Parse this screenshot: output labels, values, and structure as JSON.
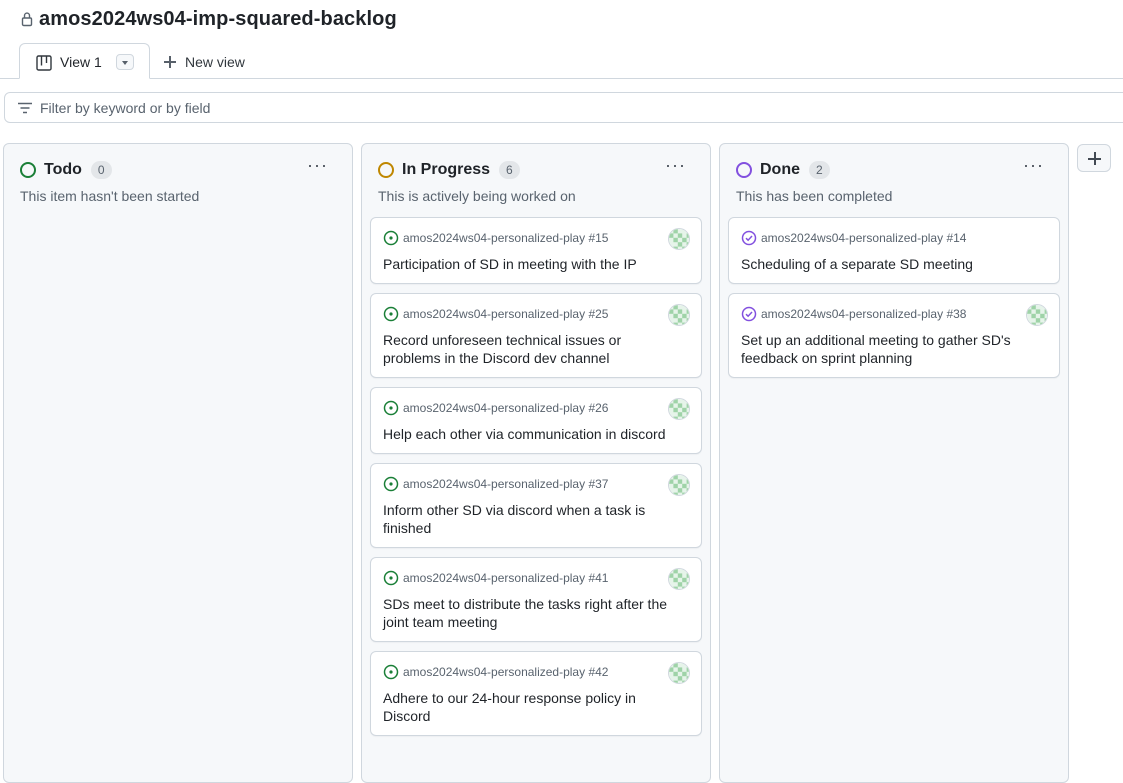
{
  "project": {
    "title": "amos2024ws04-imp-squared-backlog"
  },
  "views": {
    "active_tab": "View 1",
    "new_view_label": "New view"
  },
  "filter": {
    "placeholder": "Filter by keyword or by field"
  },
  "colors": {
    "todo": "#1a7f37",
    "in_progress": "#9a6700",
    "done": "#8250df",
    "open_issue": "#1a7f37",
    "closed_issue": "#8250df"
  },
  "columns": [
    {
      "name": "Todo",
      "count": "0",
      "description": "This item hasn't been started",
      "cards": []
    },
    {
      "name": "In Progress",
      "count": "6",
      "description": "This is actively being worked on",
      "cards": [
        {
          "repo": "amos2024ws04-personalized-play #15",
          "title": "Participation of SD in meeting with the IP",
          "state": "open"
        },
        {
          "repo": "amos2024ws04-personalized-play #25",
          "title": "Record unforeseen technical issues or problems in the Discord dev channel",
          "state": "open"
        },
        {
          "repo": "amos2024ws04-personalized-play #26",
          "title": "Help each other via communication in discord",
          "state": "open"
        },
        {
          "repo": "amos2024ws04-personalized-play #37",
          "title": "Inform other SD via discord when a task is finished",
          "state": "open"
        },
        {
          "repo": "amos2024ws04-personalized-play #41",
          "title": "SDs meet to distribute the tasks right after the joint team meeting",
          "state": "open"
        },
        {
          "repo": "amos2024ws04-personalized-play #42",
          "title": "Adhere to our 24-hour response policy in Discord",
          "state": "open"
        }
      ]
    },
    {
      "name": "Done",
      "count": "2",
      "description": "This has been completed",
      "cards": [
        {
          "repo": "amos2024ws04-personalized-play #14",
          "title": "Scheduling of a separate SD meeting",
          "state": "closed",
          "avatar": false
        },
        {
          "repo": "amos2024ws04-personalized-play #38",
          "title": "Set up an additional meeting to gather SD's feedback on sprint planning",
          "state": "closed",
          "avatar": true
        }
      ]
    }
  ],
  "icons": {
    "lock": "lock-icon",
    "board": "project-board-icon",
    "dropdown": "triangle-down-icon",
    "plus": "plus-icon",
    "filter": "filter-icon",
    "column_menu": "kebab-horizontal-icon",
    "open_issue": "issue-opened-icon",
    "closed_issue": "issue-closed-icon",
    "avatar": "identicon-avatar"
  }
}
